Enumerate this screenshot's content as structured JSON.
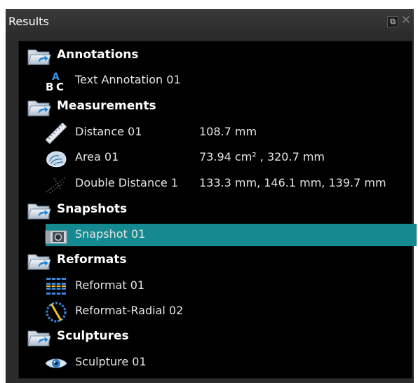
{
  "panel": {
    "title": "Results",
    "float_icon": "float-window-icon",
    "close_icon": "close-icon"
  },
  "tree": {
    "annotations": {
      "label": "Annotations",
      "icon": "folder-icon",
      "items": [
        {
          "label": "Text Annotation 01",
          "icon": "text-annotation-icon"
        }
      ]
    },
    "measurements": {
      "label": "Measurements",
      "icon": "folder-icon",
      "items": [
        {
          "label": "Distance 01",
          "value": "108.7 mm",
          "icon": "ruler-icon"
        },
        {
          "label": "Area 01",
          "value": "73.94 cm² , 320.7 mm",
          "icon": "area-icon"
        },
        {
          "label": "Double Distance 1",
          "value": "133.3 mm, 146.1 mm, 139.7 mm",
          "icon": "double-distance-icon"
        }
      ]
    },
    "snapshots": {
      "label": "Snapshots",
      "icon": "folder-icon",
      "items": [
        {
          "label": "Snapshot 01",
          "icon": "camera-icon",
          "selected": true
        }
      ]
    },
    "reformats": {
      "label": "Reformats",
      "icon": "folder-icon",
      "items": [
        {
          "label": "Reformat 01",
          "icon": "reformat-grid-icon"
        },
        {
          "label": "Reformat-Radial 02",
          "icon": "reformat-radial-icon"
        }
      ]
    },
    "sculptures": {
      "label": "Sculptures",
      "icon": "folder-icon",
      "items": [
        {
          "label": "Sculpture 01",
          "icon": "eye-icon"
        }
      ]
    }
  },
  "colors": {
    "selection": "#148a90",
    "tree_background": "#000000",
    "panel_background": "#2b2b2b",
    "text": "#e4e4e4"
  }
}
